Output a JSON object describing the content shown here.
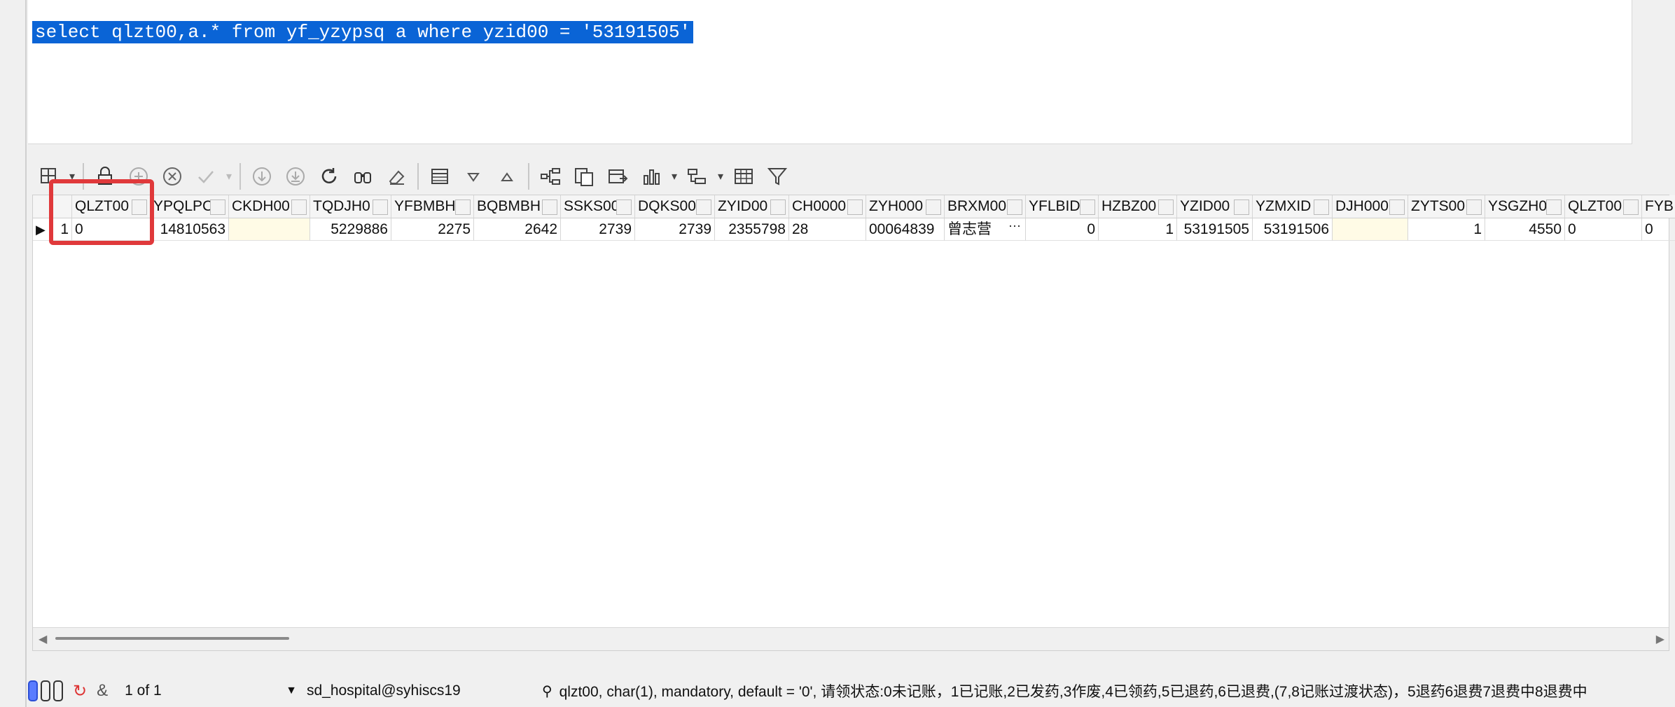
{
  "editor": {
    "sql": "select qlzt00,a.* from yf_yzypsq a where yzid00 = '53191505'"
  },
  "toolbar": {
    "icons": [
      "grid-config-icon",
      "lock-icon",
      "add-row-icon",
      "delete-row-icon",
      "apply-icon",
      "fetch-next-icon",
      "fetch-all-icon",
      "refresh-icon",
      "find-icon",
      "clear-icon",
      "record-view-icon",
      "filter-down-icon",
      "filter-up-icon",
      "tree-icon",
      "copy-icon",
      "export-icon",
      "chart-icon",
      "group-icon",
      "table-icon",
      "funnel-icon"
    ]
  },
  "grid": {
    "columns": [
      "QLZT00",
      "YPQLPC",
      "CKDH00",
      "TQDJH0",
      "YFBMBH",
      "BQBMBH",
      "SSKS00",
      "DQKS00",
      "ZYID00",
      "CH0000",
      "ZYH000",
      "BRXM00",
      "YFLBID",
      "HZBZ00",
      "YZID00",
      "YZMXID",
      "DJH000",
      "ZYTS00",
      "YSGZH0",
      "QLZT00",
      "FYB"
    ],
    "rows": [
      {
        "num": "1",
        "values": [
          "0",
          "14810563",
          "",
          "5229886",
          "2275",
          "2642",
          "2739",
          "2739",
          "2355798",
          "28",
          "00064839",
          "曾志营",
          "0",
          "1",
          "53191505",
          "53191506",
          "",
          "1",
          "4550",
          "0",
          "0"
        ]
      }
    ],
    "ellipsis": "···"
  },
  "status": {
    "page": "1 of 1",
    "connection": "sd_hospital@syhiscs19",
    "column_info": "qlzt00, char(1), mandatory, default = '0', 请领状态:0未记账，1已记账,2已发药,3作废,4已领药,5已退药,6已退费,(7,8记账过渡状态)，5退药6退费7退费中8退费中"
  },
  "colors": {
    "selection": "#0a64d6",
    "highlight": "#e0393b",
    "empty_cell": "#fffbe6"
  }
}
